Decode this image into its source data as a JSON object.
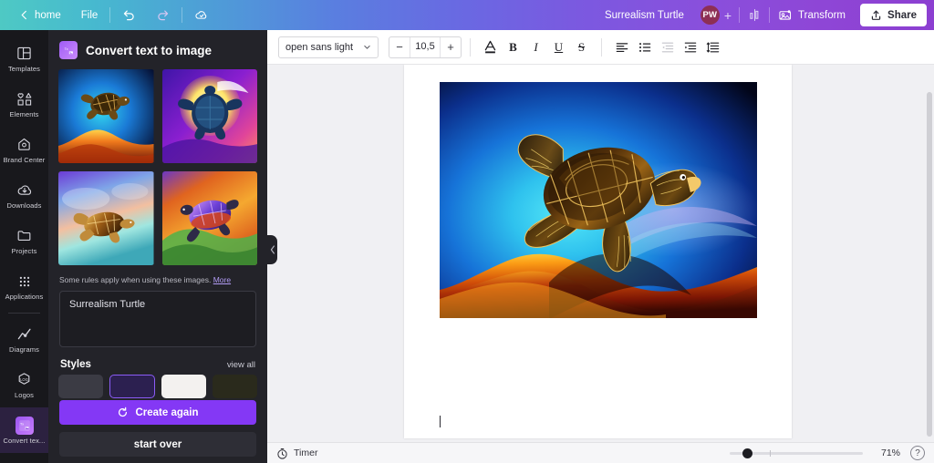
{
  "topbar": {
    "back_label": "home",
    "file_label": "File",
    "undo_icon": "undo-icon",
    "redo_icon": "redo-icon",
    "cloud_icon": "cloud-sync-icon",
    "doc_title": "Surrealism Turtle",
    "avatar_initials": "PW",
    "add_person": "+",
    "stats_icon": "bar-chart-icon",
    "transform_label": "Transform",
    "transform_icon": "transform-icon",
    "share_label": "Share",
    "share_icon": "upload-icon",
    "gradient_start": "#4ec9c4",
    "gradient_end": "#8c3fd1"
  },
  "rail": {
    "items": [
      {
        "label": "Templates",
        "icon": "templates-icon",
        "active": false
      },
      {
        "label": "Elements",
        "icon": "elements-icon",
        "active": false
      },
      {
        "label": "Brand Center",
        "icon": "brand-center-icon",
        "active": false
      },
      {
        "label": "Downloads",
        "icon": "downloads-icon",
        "active": false
      },
      {
        "label": "Projects",
        "icon": "projects-folder-icon",
        "active": false
      },
      {
        "label": "Applications",
        "icon": "applications-grid-icon",
        "active": false
      },
      {
        "label": "Diagrams",
        "icon": "diagrams-chart-icon",
        "active": false
      },
      {
        "label": "Logos",
        "icon": "logos-icon",
        "active": false
      },
      {
        "label": "Convert tex...",
        "icon": "convert-text-to-image-icon",
        "active": true
      }
    ]
  },
  "panel": {
    "title": "Convert text to image",
    "badge_icon": "convert-text-to-image-icon",
    "thumbnails": [
      {
        "name": "generated-image-1",
        "alt": "turtle over orange dune on blue background"
      },
      {
        "name": "generated-image-2",
        "alt": "blue turtle in front of yellow moon on purple background"
      },
      {
        "name": "generated-image-3",
        "alt": "brown turtle swimming over pastel water"
      },
      {
        "name": "generated-image-4",
        "alt": "colorful turtle on orange and green background"
      }
    ],
    "rules_text": "Some rules apply when using these images.",
    "rules_link": "More",
    "prompt_value": "Surrealism Turtle",
    "styles_label": "Styles",
    "view_all_label": "view all",
    "style_chips": [
      {
        "name": "style-chip-1",
        "state": "normal"
      },
      {
        "name": "style-chip-2",
        "state": "selected"
      },
      {
        "name": "style-chip-3",
        "state": "light"
      },
      {
        "name": "style-chip-4",
        "state": "dark"
      }
    ],
    "create_again_label": "Create again",
    "create_again_icon": "refresh-icon",
    "start_over_label": "start over",
    "collapse_icon": "chevron-left-icon",
    "accent_color": "#8438f5"
  },
  "toolbar": {
    "font_family": "open sans light",
    "font_dropdown_icon": "chevron-down-icon",
    "decrease_label": "−",
    "font_size": "10,5",
    "increase_label": "+",
    "text_color_icon": "text-color-icon",
    "bold_label": "B",
    "italic_label": "I",
    "underline_label": "U",
    "strikethrough_label": "S",
    "align_icon": "align-left-icon",
    "bullet_list_icon": "bullet-list-icon",
    "outdent_icon": "outdent-icon",
    "indent_icon": "indent-icon",
    "line_spacing_icon": "line-spacing-icon"
  },
  "canvas": {
    "artwork_name": "surrealism-turtle-artwork",
    "artwork_alt": "Neon outlined sea turtle swimming above a glowing orange dune under a blue gradient sky",
    "scrollbar_name": "canvas-vertical-scrollbar"
  },
  "statusbar": {
    "timer_label": "Timer",
    "timer_icon": "stopwatch-icon",
    "zoom_percent": "71%",
    "help_label": "?"
  }
}
